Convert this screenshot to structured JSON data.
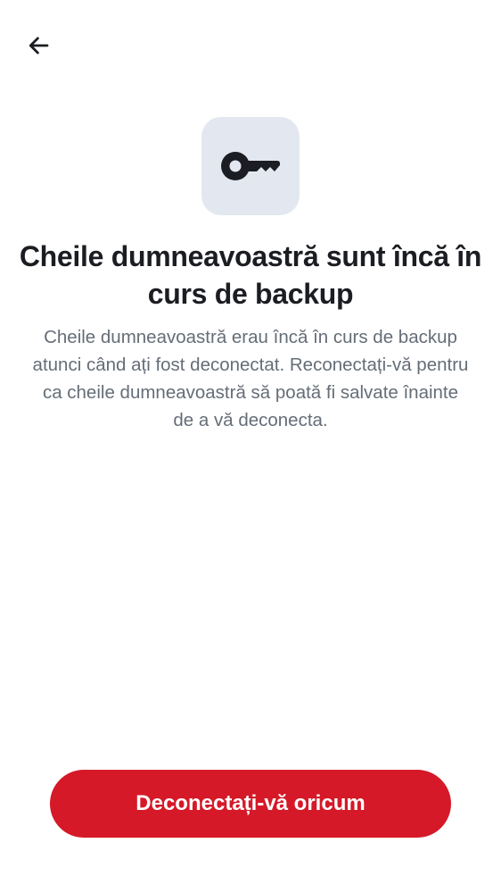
{
  "nav": {
    "back_icon": "arrow-left-icon"
  },
  "hero": {
    "icon": "key-icon",
    "tile_color": "#e3e8f0"
  },
  "content": {
    "title": "Cheile dumneavoastră sunt încă în curs de backup",
    "description": "Cheile dumneavoastră erau încă în curs de backup atunci când ați fost deconectat. Reconectați-vă pentru ca cheile dumneavoastră să poată fi salvate înainte de a vă deconecta."
  },
  "actions": {
    "signout_anyway_label": "Deconectați-vă oricum"
  },
  "colors": {
    "accent": "#d51928",
    "title": "#1b1d22",
    "body_text": "#656d77"
  }
}
